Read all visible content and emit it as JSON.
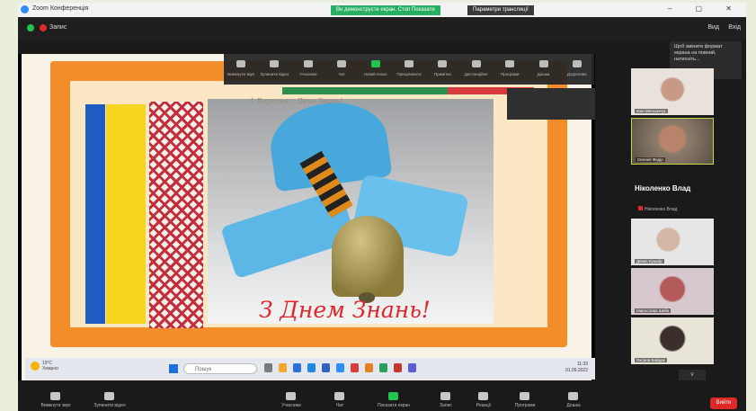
{
  "window": {
    "title": "Zoom Конференція",
    "share_status": "Ви демонструєте екран. Стоп Показати",
    "share_options": "Параметри трансляції"
  },
  "topbar": {
    "rec_label": "Запис",
    "view_label": "Вид",
    "fullscreen_label": "Вхід"
  },
  "tooltip": {
    "text": "Щоб змінити формат екрана на повний, натисніть..."
  },
  "slide": {
    "caption": "1 Вересня – День Знань!",
    "greeting": "З Днем Знань!"
  },
  "share_toolbar": [
    {
      "icon": "mic-icon",
      "label": "Вимкнути звук"
    },
    {
      "icon": "video-icon",
      "label": "Зупинити відео"
    },
    {
      "icon": "participants-icon",
      "label": "Учасники"
    },
    {
      "icon": "chat-icon",
      "label": "Чат"
    },
    {
      "icon": "new-share-icon",
      "label": "Новий показ"
    },
    {
      "icon": "pause-icon",
      "label": "Призупинити"
    },
    {
      "icon": "annotate-icon",
      "label": "Примітки"
    },
    {
      "icon": "remote-icon",
      "label": "Дистанційне"
    },
    {
      "icon": "apps-icon",
      "label": "Програми"
    },
    {
      "icon": "whiteboard-icon",
      "label": "Дошка"
    },
    {
      "icon": "more-icon",
      "label": "Додатково"
    }
  ],
  "taskbar": {
    "weather_temp": "19°C",
    "weather_desc": "Хмарно",
    "search_placeholder": "Пошук",
    "time": "11:33",
    "date": "01.09.2022"
  },
  "gallery": {
    "tiles": [
      {
        "name": "Іван Мельничук"
      },
      {
        "name": "Євгенія Федір"
      }
    ],
    "active_name": "Ніколенко Влад",
    "active_sub": "Ніколенко Влад",
    "more_tiles": [
      {
        "name": "Денис Кушнір"
      },
      {
        "name": "Мирослава Шиба"
      },
      {
        "name": "Оксана Байдак"
      }
    ],
    "page_down": "v"
  },
  "bottom_toolbar": [
    {
      "icon": "mic-icon",
      "label": "Вимкнути звук"
    },
    {
      "icon": "video-icon",
      "label": "Зупинити відео"
    },
    {
      "icon": "participants-icon",
      "label": "Учасники"
    },
    {
      "icon": "chat-icon",
      "label": "Чат"
    },
    {
      "icon": "share-screen-icon",
      "label": "Показати екран"
    },
    {
      "icon": "record-icon",
      "label": "Запис"
    },
    {
      "icon": "reactions-icon",
      "label": "Реакції"
    },
    {
      "icon": "apps-icon",
      "label": "Програми"
    },
    {
      "icon": "whiteboard-icon",
      "label": "Дошка"
    }
  ],
  "end_button": "Вийти"
}
